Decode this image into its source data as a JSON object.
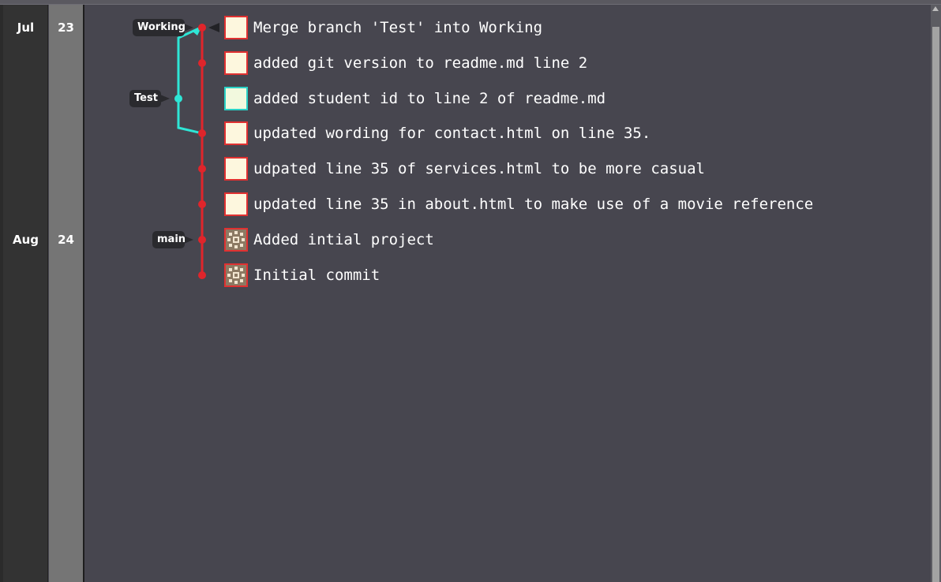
{
  "dates": [
    {
      "month": "Jul",
      "day": "23"
    },
    {
      "month": "Aug",
      "day": "24"
    }
  ],
  "branches": {
    "working": "Working",
    "test": "Test",
    "main": "main"
  },
  "commits": [
    {
      "message": "Merge branch 'Test' into Working",
      "avatar": "blank"
    },
    {
      "message": "added git version to readme.md line 2",
      "avatar": "blank"
    },
    {
      "message": "added student id to line 2 of readme.md",
      "avatar": "blank-cyan"
    },
    {
      "message": "updated wording for contact.html on line 35.",
      "avatar": "blank"
    },
    {
      "message": "udpated line 35 of services.html to be more casual",
      "avatar": "blank"
    },
    {
      "message": "updated line 35 in about.html to make use of a movie reference",
      "avatar": "blank"
    },
    {
      "message": "Added intial project",
      "avatar": "identicon"
    },
    {
      "message": "Initial commit",
      "avatar": "identicon"
    }
  ],
  "colors": {
    "main_line": "#e0252b",
    "test_line": "#2ee6d6",
    "background": "#47464f"
  }
}
